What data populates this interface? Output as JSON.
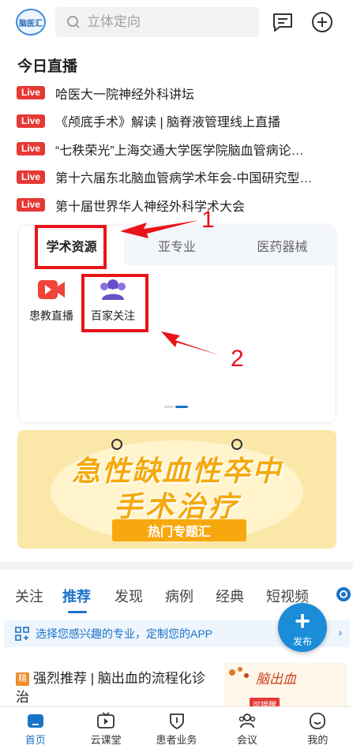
{
  "header": {
    "logo_text": "脑医汇",
    "search_placeholder": "立体定向",
    "message_icon": "message-square-icon",
    "add_icon": "plus-circle-icon"
  },
  "live": {
    "title": "今日直播",
    "badge": "Live",
    "items": [
      {
        "text": "哈医大一院神经外科讲坛"
      },
      {
        "text": "《颅底手术》解读 | 脑脊液管理线上直播"
      },
      {
        "text": "“七秩荣光”上海交通大学医学院脑血管病论…"
      },
      {
        "text": "第十六届东北脑血管病学术年会-中国研究型…"
      },
      {
        "text": "第十届世界华人神经外科学术大会"
      }
    ]
  },
  "resources": {
    "tabs": [
      {
        "label": "学术资源"
      },
      {
        "label": "亚专业"
      },
      {
        "label": "医药器械"
      }
    ],
    "items": [
      {
        "label": "患教直播",
        "icon": "video-camera-icon"
      },
      {
        "label": "百家关注",
        "icon": "users-icon"
      }
    ]
  },
  "annotations": {
    "num1": "1",
    "num2": "2"
  },
  "banner": {
    "line1": "急性缺血性卒中",
    "line2": "手术治疗",
    "tag": "热门专题汇"
  },
  "feed": {
    "tabs": [
      {
        "label": "关注"
      },
      {
        "label": "推荐"
      },
      {
        "label": "发现"
      },
      {
        "label": "病例"
      },
      {
        "label": "经典"
      },
      {
        "label": "短视频"
      }
    ],
    "custom_text": "选择您感兴趣的专业，定制您的APP",
    "fab_label": "发布"
  },
  "article": {
    "tag": "精",
    "title": "强烈推荐 | 脑出血的流程化诊治",
    "image_text": "脑出血",
    "image_badge": "可提醒"
  },
  "bottom_nav": {
    "items": [
      {
        "label": "首页"
      },
      {
        "label": "云课堂"
      },
      {
        "label": "患者业务"
      },
      {
        "label": "会议"
      },
      {
        "label": "我的"
      }
    ]
  },
  "colors": {
    "accent": "#1a73c8",
    "live_red": "#e53935",
    "annotation_red": "#e8141a",
    "banner_bg": "#fbe7a8"
  }
}
